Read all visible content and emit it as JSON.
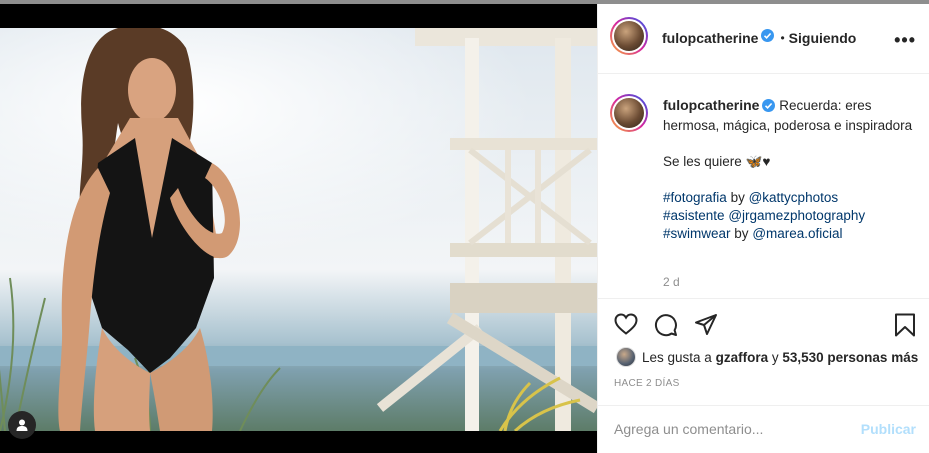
{
  "post": {
    "username": "fulopcatherine",
    "separator": "•",
    "follow_status": "Siguiendo",
    "caption_lines": [
      "Recuerda: eres hermosa, mágica, poderosa e inspiradora",
      "Se les quiere 🦋♥"
    ],
    "credits": [
      {
        "tag": "#fotografia",
        "by": "by",
        "handle": "@kattycphotos"
      },
      {
        "tag": "#asistente",
        "by": "",
        "handle": "@jrgamezphotography"
      },
      {
        "tag": "#swimwear",
        "by": "by",
        "handle": "@marea.oficial"
      }
    ],
    "caption_age": "2 d",
    "likes_prefix": "Les gusta a",
    "likes_user": "gzaffora",
    "likes_connector": "y",
    "likes_count": "53,530 personas más",
    "timestamp": "HACE 2 DÍAS",
    "comment_placeholder": "Agrega un comentario...",
    "publish_label": "Publicar",
    "more_label": "•••"
  },
  "icons": {
    "verified": "verified-badge-icon",
    "like": "heart-icon",
    "comment": "comment-bubble-icon",
    "share": "paper-plane-icon",
    "save": "bookmark-icon",
    "user_tag": "user-tag-icon"
  },
  "colors": {
    "link": "#00376b",
    "verified": "#3897f0",
    "publish_disabled": "#b2dffc",
    "muted": "#8e8e8e",
    "text": "#262626"
  }
}
